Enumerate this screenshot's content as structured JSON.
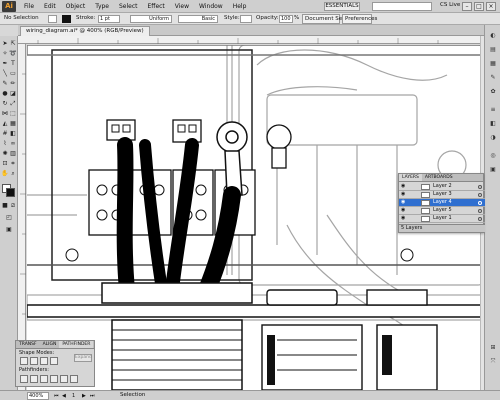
{
  "menubar": {
    "app_logo": "Ai",
    "items": [
      "File",
      "Edit",
      "Object",
      "Type",
      "Select",
      "Effect",
      "View",
      "Window",
      "Help"
    ],
    "workspace": "ESSENTIALS",
    "cs_live": "CS Live"
  },
  "controlbar": {
    "selection_label": "No Selection",
    "stroke_label": "Stroke:",
    "stroke_weight": "1 pt",
    "uniform_label": "Uniform",
    "basic_label": "Basic",
    "style_label": "Style:",
    "opacity_label": "Opacity:",
    "opacity_value": "100",
    "opacity_unit": "%",
    "doc_setup": "Document Setup",
    "preferences": "Preferences"
  },
  "document": {
    "tab_title": "wiring_diagram.ai* @ 400% (RGB/Preview)"
  },
  "layers_panel": {
    "tabs": [
      "LAYERS",
      "ARTBOARDS"
    ],
    "rows": [
      "Layer 2",
      "Layer 3",
      "Layer 4",
      "Layer 5",
      "Layer 1"
    ],
    "selected_index": 2,
    "footer": "5 Layers"
  },
  "pathfinder_panel": {
    "tabs": [
      "TRANSF",
      "ALIGN",
      "PATHFINDER"
    ],
    "shape_modes_label": "Shape Modes:",
    "pathfinders_label": "Pathfinders:",
    "expand_label": "Expand"
  },
  "statusbar": {
    "zoom": "400%",
    "page": "1",
    "current_tool": "Selection"
  },
  "colors": {
    "selected_layer": "#2f6fd0",
    "app_logo_accent": "#f0a030"
  }
}
